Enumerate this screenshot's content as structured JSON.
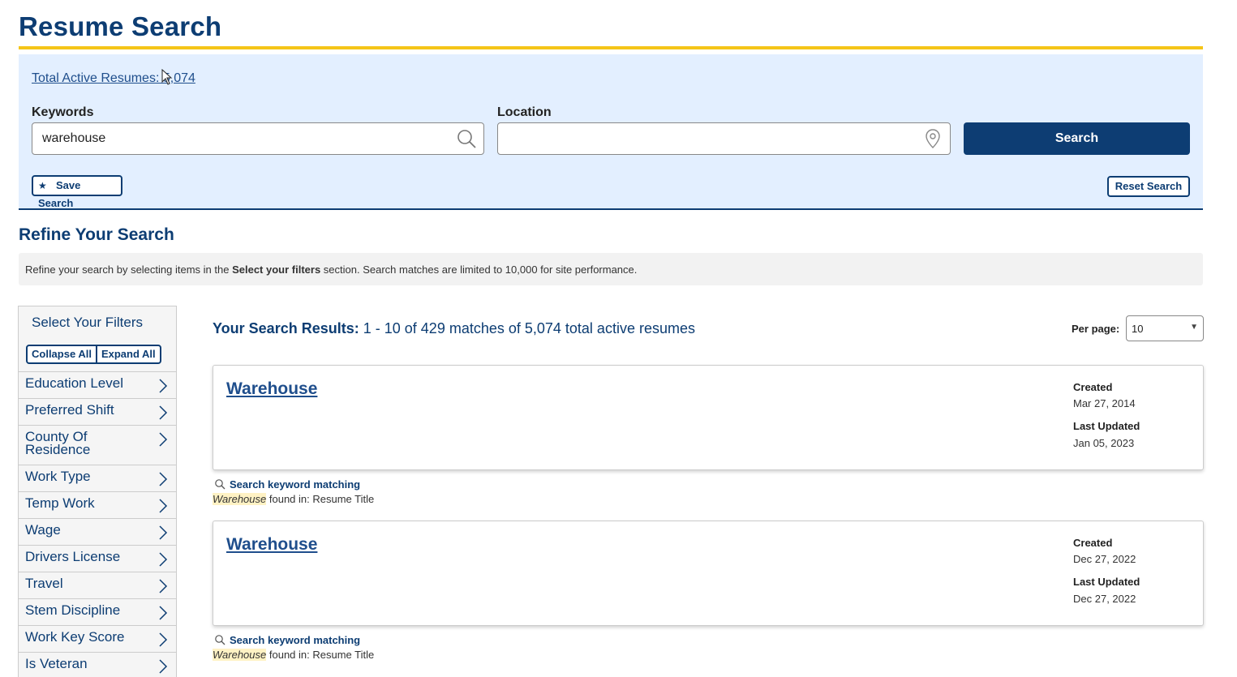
{
  "page": {
    "title": "Resume Search"
  },
  "search": {
    "total_link": "Total Active Resumes: 5,074",
    "keywords_label": "Keywords",
    "keywords_value": "warehouse",
    "location_label": "Location",
    "location_value": "",
    "search_button": "Search",
    "save_search_button": "Save Search",
    "reset_search_button": "Reset Search"
  },
  "refine": {
    "title": "Refine Your Search",
    "note_before": "Refine your search by selecting items in the ",
    "note_bold": "Select your filters",
    "note_after": " section. Search matches are limited to 10,000 for site performance."
  },
  "filters": {
    "title": "Select Your Filters",
    "collapse_all": "Collapse All",
    "expand_all": "Expand All",
    "items": [
      {
        "label": "Education Level"
      },
      {
        "label": "Preferred Shift"
      },
      {
        "label": "County Of Residence"
      },
      {
        "label": "Work Type"
      },
      {
        "label": "Temp Work"
      },
      {
        "label": "Wage"
      },
      {
        "label": "Drivers License"
      },
      {
        "label": "Travel"
      },
      {
        "label": "Stem Discipline"
      },
      {
        "label": "Work Key Score"
      },
      {
        "label": "Is Veteran"
      }
    ]
  },
  "results": {
    "heading_label": "Your Search Results:",
    "heading_text": "1 - 10 of 429 matches of 5,074 total active resumes",
    "per_page_label": "Per page:",
    "per_page_value": "10",
    "items": [
      {
        "title": "Warehouse",
        "created_label": "Created",
        "created": "Mar 27, 2014",
        "updated_label": "Last Updated",
        "updated": "Jan 05, 2023",
        "match_heading": "Search keyword matching",
        "match_term": "Warehouse",
        "match_text": "found in: Resume Title"
      },
      {
        "title": "Warehouse",
        "created_label": "Created",
        "created": "Dec 27, 2022",
        "updated_label": "Last Updated",
        "updated": "Dec 27, 2022",
        "match_heading": "Search keyword matching",
        "match_term": "Warehouse",
        "match_text": "found in: Resume Title"
      }
    ]
  },
  "colors": {
    "brand_navy": "#0d3d73",
    "accent_yellow": "#f5c518",
    "panel_blue": "#e3efff",
    "highlight": "#fff2c4"
  }
}
